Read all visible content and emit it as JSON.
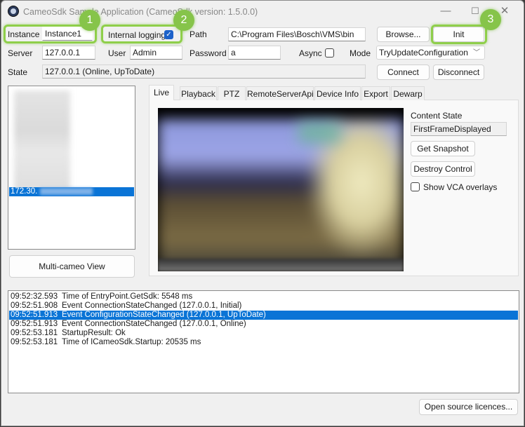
{
  "window": {
    "title": "CameoSdk Sample Application (CameoSdk version: 1.5.0.0)",
    "controls": {
      "minimize": "—",
      "maximize": "☐",
      "close": "✕"
    }
  },
  "form": {
    "instance_label": "Instance",
    "instance_value": "Instance1",
    "internal_logging_label": "Internal logging",
    "internal_logging_checked": true,
    "path_label": "Path",
    "path_value": "C:\\Program Files\\Bosch\\VMS\\bin",
    "browse_label": "Browse...",
    "init_label": "Init",
    "server_label": "Server",
    "server_value": "127.0.0.1",
    "user_label": "User",
    "user_value": "Admin",
    "password_label": "Password",
    "password_value": "a",
    "async_label": "Async",
    "async_checked": false,
    "mode_label": "Mode",
    "mode_value": "TryUpdateConfiguration",
    "state_label": "State",
    "state_value": "127.0.0.1 (Online, UpToDate)",
    "connect_label": "Connect",
    "disconnect_label": "Disconnect"
  },
  "annotations": {
    "badge1": "1",
    "badge2": "2",
    "badge3": "3",
    "color": "#86c44a"
  },
  "device_list": {
    "selected_item": "172.30."
  },
  "multi_cameo_label": "Multi-cameo View",
  "tabs": [
    {
      "label": "Live",
      "active": true
    },
    {
      "label": "Playback"
    },
    {
      "label": "PTZ"
    },
    {
      "label": "RemoteServerApi"
    },
    {
      "label": "Device Info"
    },
    {
      "label": "Export"
    },
    {
      "label": "Dewarp"
    }
  ],
  "live": {
    "content_state_label": "Content State",
    "content_state_value": "FirstFrameDisplayed",
    "get_snapshot_label": "Get Snapshot",
    "destroy_control_label": "Destroy Control",
    "show_vca_label": "Show VCA overlays",
    "show_vca_checked": false
  },
  "log": [
    {
      "time": "09:52:32.593",
      "message": "Time of EntryPoint.GetSdk: 5548 ms"
    },
    {
      "time": "09:52:51.908",
      "message": "Event ConnectionStateChanged (127.0.0.1, Initial)"
    },
    {
      "time": "09:52:51.913",
      "message": "Event ConfigurationStateChanged (127.0.0.1, UpToDate)",
      "selected": true
    },
    {
      "time": "09:52:51.913",
      "message": "Event ConnectionStateChanged (127.0.0.1, Online)"
    },
    {
      "time": "09:52:53.181",
      "message": "StartupResult: Ok"
    },
    {
      "time": "09:52:53.181",
      "message": "Time of ICameoSdk.Startup: 20535 ms"
    }
  ],
  "open_source_label": "Open source licences..."
}
